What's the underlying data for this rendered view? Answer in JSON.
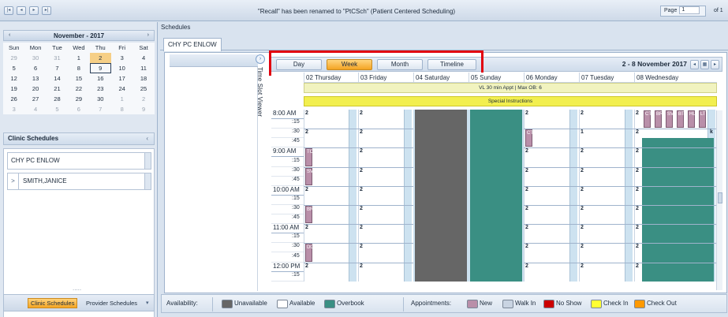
{
  "topbar": {
    "notification": "\"Recall\" has been renamed to \"PtCSch\" (Patient Centered Scheduling)",
    "page_label": "Page",
    "page_value": "1",
    "page_of": "of 1"
  },
  "calendar": {
    "prev": "‹",
    "next": "›",
    "month": "November - 2017",
    "weekdays": [
      "Sun",
      "Mon",
      "Tue",
      "Wed",
      "Thu",
      "Fri",
      "Sat"
    ],
    "weeks": [
      [
        "29",
        "30",
        "31",
        "1",
        "2",
        "3",
        "4"
      ],
      [
        "5",
        "6",
        "7",
        "8",
        "9",
        "10",
        "11"
      ],
      [
        "12",
        "13",
        "14",
        "15",
        "16",
        "17",
        "18"
      ],
      [
        "19",
        "20",
        "21",
        "22",
        "23",
        "24",
        "25"
      ],
      [
        "26",
        "27",
        "28",
        "29",
        "30",
        "1",
        "2"
      ],
      [
        "3",
        "4",
        "5",
        "6",
        "7",
        "8",
        "9"
      ]
    ]
  },
  "clinic_schedules": {
    "title": "Clinic Schedules",
    "collapse": "‹",
    "clinic": "CHY PC ENLOW",
    "provider_expand": ">",
    "provider": "SMITH,JANICE"
  },
  "left_bottom": {
    "clinic_btn": "Clinic Schedules",
    "provider_btn": "Provider Schedules",
    "more": "▾",
    "dots": "....."
  },
  "schedules": {
    "title": "Schedules",
    "tab": "CHY PC ENLOW",
    "tsv_label": "Time Slot Viewer",
    "tsv_btn": "›"
  },
  "viewbar": {
    "day": "Day",
    "week": "Week",
    "month": "Month",
    "timeline": "Timeline",
    "range": "2 - 8 November 2017",
    "btn_prev": "◂",
    "btn_mid": "▦",
    "btn_next": "▸"
  },
  "days": [
    "02 Thursday",
    "03 Friday",
    "04 Saturday",
    "05 Sunday",
    "06 Monday",
    "07 Tuesday",
    "08 Wednesday"
  ],
  "banners": {
    "vl": "VL 30 min Appt | Max OB: 6",
    "special": "Special Instructions"
  },
  "time_rows": [
    {
      "hour": "8:00 AM",
      "min": ""
    },
    {
      "hour": "",
      "min": ":15"
    },
    {
      "hour": "",
      "min": ":30"
    },
    {
      "hour": "",
      "min": ":45"
    },
    {
      "hour": "9:00 AM",
      "min": ""
    },
    {
      "hour": "",
      "min": ":15"
    },
    {
      "hour": "",
      "min": ":30"
    },
    {
      "hour": "",
      "min": ":45"
    },
    {
      "hour": "10:00 AM",
      "min": ""
    },
    {
      "hour": "",
      "min": ":15"
    },
    {
      "hour": "",
      "min": ":30"
    },
    {
      "hour": "",
      "min": ":45"
    },
    {
      "hour": "11:00 AM",
      "min": ""
    },
    {
      "hour": "",
      "min": ":15"
    },
    {
      "hour": "",
      "min": ":30"
    },
    {
      "hour": "",
      "min": ":45"
    },
    {
      "hour": "12:00 PM",
      "min": ""
    },
    {
      "hour": "",
      "min": ":15"
    }
  ],
  "counts": {
    "thu": [
      "2",
      "",
      "2",
      "",
      "1",
      "",
      "1",
      "",
      "2",
      "",
      "1",
      "",
      "2",
      "",
      "1",
      "",
      "2",
      ""
    ],
    "fri": [
      "2",
      "",
      "2",
      "",
      "2",
      "",
      "2",
      "",
      "2",
      "",
      "2",
      "",
      "2",
      "",
      "2",
      "",
      "2",
      ""
    ],
    "mon": [
      "2",
      "",
      "2",
      "",
      "2",
      "",
      "2",
      "",
      "2",
      "",
      "2",
      "",
      "2",
      "",
      "2",
      "",
      "2",
      ""
    ],
    "tue": [
      "2",
      "",
      "1",
      "",
      "2",
      "",
      "2",
      "",
      "2",
      "",
      "2",
      "",
      "2",
      "",
      "2",
      "",
      "2",
      ""
    ],
    "wed": [
      "2",
      "",
      "2",
      "",
      "2",
      "",
      "2",
      "",
      "2",
      "",
      "2",
      "",
      "2",
      "",
      "2",
      "",
      "2",
      ""
    ]
  },
  "appts_thu": [
    "TC",
    "SV",
    "BR",
    "DC"
  ],
  "appt_mon": "CT",
  "appts_wed": [
    "CT",
    "BR",
    "SV",
    "BT",
    "HL",
    "LT"
  ],
  "wed_mark": "k",
  "legend": {
    "availability": "Availability:",
    "unavailable": "Unavailable",
    "available": "Available",
    "overbook": "Overbook",
    "appointments": "Appointments:",
    "new": "New",
    "walkin": "Walk In",
    "noshow": "No Show",
    "checkin": "Check In",
    "checkout": "Check Out",
    "colors": {
      "unavailable": "#666666",
      "available": "#ffffff",
      "overbook": "#3a8f83",
      "new": "#b98fa9",
      "walkin": "#c9d4e2",
      "noshow": "#cc0000",
      "checkin": "#ffff33",
      "checkout": "#ff9900"
    }
  }
}
